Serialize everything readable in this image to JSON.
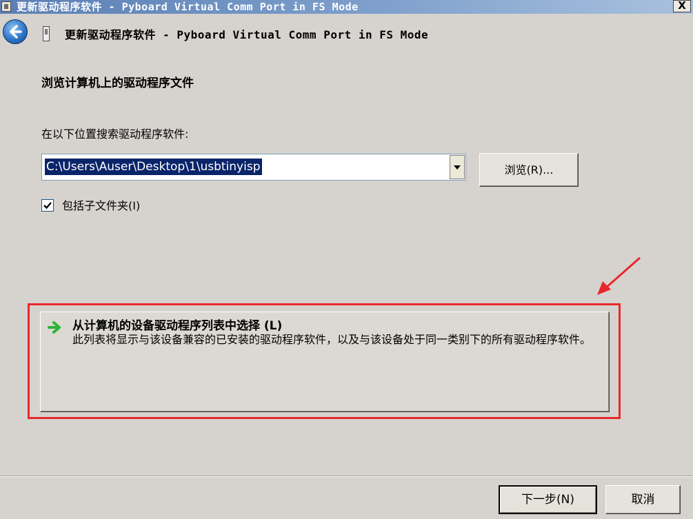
{
  "window": {
    "title": "更新驱动程序软件 - Pyboard Virtual Comm Port in FS Mode",
    "close_label": "X"
  },
  "header": {
    "title": "更新驱动程序软件 - Pyboard Virtual Comm Port in FS Mode"
  },
  "content": {
    "section_title": "浏览计算机上的驱动程序文件",
    "search_label": "在以下位置搜索驱动程序软件:",
    "path_value": "C:\\Users\\Auser\\Desktop\\1\\usbtinyisp",
    "browse_label": "浏览(R)...",
    "include_subfolders": {
      "label": "包括子文件夹(I)",
      "checked": true
    }
  },
  "choose_option": {
    "title": "从计算机的设备驱动程序列表中选择 (L)",
    "description": "此列表将显示与该设备兼容的已安装的驱动程序软件，以及与该设备处于同一类别下的所有驱动程序软件。"
  },
  "footer": {
    "next_label": "下一步(N)",
    "cancel_label": "取消"
  },
  "colors": {
    "dialog_bg": "#d6d3ce",
    "selection_bg": "#0a246a",
    "annotation_red": "#e8272b",
    "arrow_green": "#2bb43a"
  }
}
